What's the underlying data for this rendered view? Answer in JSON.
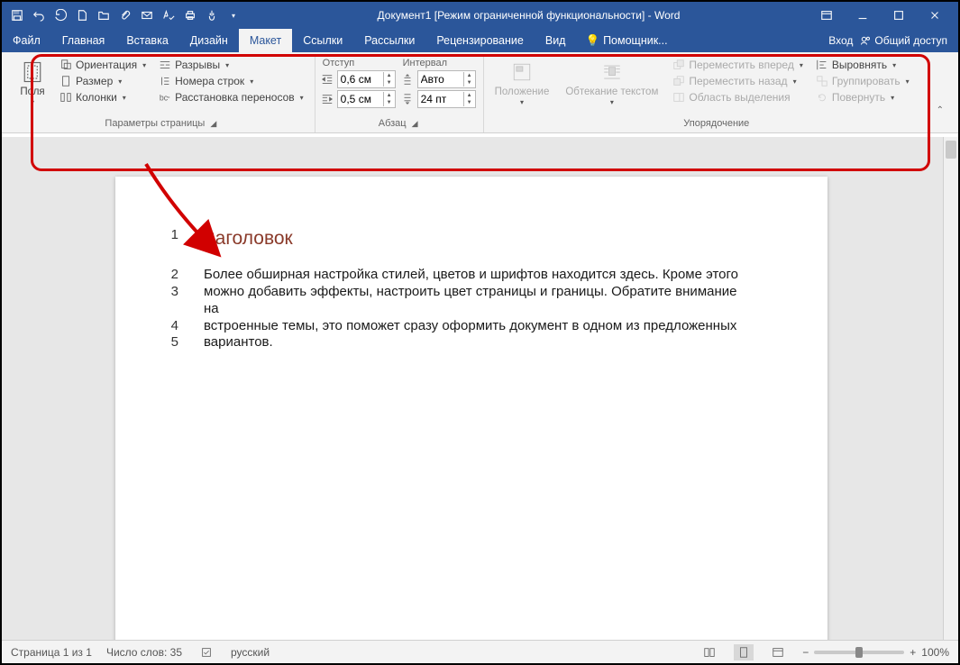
{
  "title": "Документ1 [Режим ограниченной функциональности] - Word",
  "tabs": {
    "file": "Файл",
    "home": "Главная",
    "insert": "Вставка",
    "design": "Дизайн",
    "layout": "Макет",
    "references": "Ссылки",
    "mailings": "Рассылки",
    "review": "Рецензирование",
    "view": "Вид",
    "tell": "Помощник...",
    "signin": "Вход",
    "share": "Общий доступ"
  },
  "ribbon": {
    "pageSetup": {
      "margins": "Поля",
      "orientation": "Ориентация",
      "size": "Размер",
      "columns": "Колонки",
      "breaks": "Разрывы",
      "lineNumbers": "Номера строк",
      "hyphenation": "Расстановка переносов",
      "groupLabel": "Параметры страницы"
    },
    "paragraph": {
      "indentLabel": "Отступ",
      "spacingLabel": "Интервал",
      "indentLeft": "0,6 см",
      "indentRight": "0,5 см",
      "spacingBefore": "Авто",
      "spacingAfter": "24 пт",
      "groupLabel": "Абзац"
    },
    "arrange": {
      "position": "Положение",
      "wrap": "Обтекание текстом",
      "bringForward": "Переместить вперед",
      "sendBackward": "Переместить назад",
      "selectionPane": "Область выделения",
      "align": "Выровнять",
      "group": "Группировать",
      "rotate": "Повернуть",
      "groupLabel": "Упорядочение"
    }
  },
  "document": {
    "headingNum": "1",
    "heading": "Заголовок",
    "lines": [
      {
        "n": "2",
        "t": "Более обширная настройка стилей, цветов и шрифтов находится здесь. Кроме этого"
      },
      {
        "n": "3",
        "t": "можно добавить эффекты, настроить цвет страницы и границы. Обратите внимание на"
      },
      {
        "n": "4",
        "t": "встроенные темы, это поможет сразу оформить документ в одном из предложенных"
      },
      {
        "n": "5",
        "t": "вариантов."
      }
    ]
  },
  "status": {
    "page": "Страница 1 из 1",
    "words": "Число слов: 35",
    "lang": "русский",
    "zoom": "100%"
  }
}
